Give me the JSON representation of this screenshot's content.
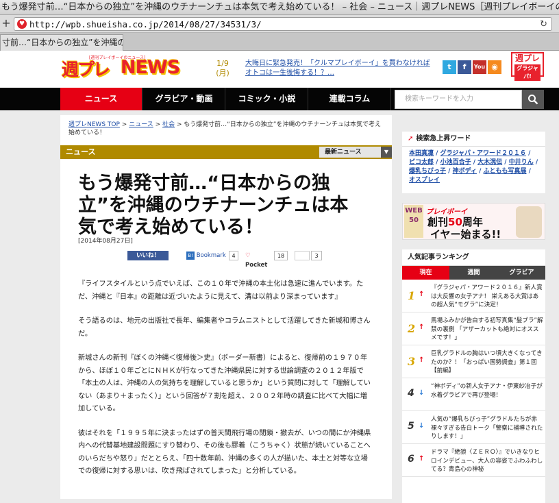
{
  "browser": {
    "window_title": "もう爆発寸前…“日本からの独立”を沖縄のウチナーンチュは本気で考え始めている！ – 社会 – ニュース｜週プレNEWS［週刊プレイボーイの",
    "url": "http://wpb.shueisha.co.jp/2014/08/27/34531/3/",
    "tab_title": "寸前…“日本からの独立”を沖縄のウチ…"
  },
  "header": {
    "logo_weekly": "週プレ",
    "logo_news": "NEWS",
    "logo_sub": "[週刊プレイボーイのニュース]",
    "date": "1/9",
    "weekday": "(月)",
    "headline_link": "大晦日に緊急発売！「クルマプレイボーイ」を買わなければオトコは一生後悔する！？…",
    "social": [
      "twitter-icon",
      "facebook-icon",
      "youtube-icon",
      "rss-icon"
    ],
    "badge_top": "週プレ",
    "badge_bottom": "グラジャパ!"
  },
  "nav": {
    "items": [
      "ニュース",
      "グラビア・動画",
      "コミック・小説",
      "連載コラム"
    ],
    "search_placeholder": "検索キーワードを入力"
  },
  "breadcrumb": {
    "home": "週プレNEWS TOP",
    "sep1": ">",
    "news": "ニュース",
    "sep2": ">",
    "category": "社会",
    "sep3": ">",
    "current": "もう爆発寸前…“日本からの独立”を沖縄のウチナーンチュは本気で考え始めている！"
  },
  "section": {
    "label": "ニュース",
    "latest": "最新ニュース"
  },
  "article": {
    "title": "もう爆発寸前…“日本からの独立”を沖縄のウチナーンチュは本気で考え始めている！",
    "date": "[2014年08月27日]",
    "share": {
      "like": "いいね！",
      "bookmark": "Bookmark",
      "bookmark_count": "4",
      "pocket": "Pocket",
      "pocket_count": "18",
      "other_count": "3"
    },
    "paragraphs": [
      "『ライフスタイルという点でいえば、この１０年で沖縄の本土化は急速に進んでいます。ただ、沖縄と『日本』の距離は近づいたように見えて、溝は以前より深まっています』",
      "そう語るのは、地元の出版社で長年、編集者やコラムニストとして活躍してきた新城和博さんだ。",
      "新城さんの新刊『ぼくの沖縄＜復帰後＞史』（ボーダー新書）によると、復帰前の１９７０年から、ほぼ１０年ごとにＮＨＫが行なってきた沖縄県民に対する世論調査の２０１２年版で「本土の人は、沖縄の人の気持ちを理解していると思うか」という質問に対して「理解していない（あまり＋まったく）」という回答が７割を超え、２００２年時の調査に比べて大幅に増加している。",
      "彼はそれを「１９９５年に決まったはずの普天間飛行場の閉鎖・撤去が、いつの間にか沖縄県内への代替基地建設問題にすり替わり、その後も膠着（こうちゃく）状態が続いていることへのいらだちや怒り」だととらえ、「四十数年前、沖縄の多くの人が描いた、本土と対等な立場での復帰に対する思いは、吹き飛ばされてしまった」と分析している。"
    ]
  },
  "sidebar": {
    "trend_title": "検索急上昇ワード",
    "trend_words": [
      "本田真凜",
      "グラジャパ・アワード２０１６",
      "ピコ太郎",
      "小池百合子",
      "大木滉伝",
      "中井りん",
      "爆乳ちびっ子",
      "神ボディ",
      "ふともも写真展",
      "オスプレイ"
    ],
    "banner_tag": "プレイボーイ",
    "banner_left": "WEB 50",
    "banner_line1_pre": "創刊",
    "banner_line1_num": "50",
    "banner_line1_post": "周年",
    "banner_line2": "イヤー始まる!!",
    "ranking_title": "人気記事ランキング",
    "ranking_tabs": [
      "現在",
      "週間",
      "グラビア"
    ],
    "ranking": [
      {
        "rank": "1",
        "trend": "up",
        "text": "『グラジャパ・アワード２０１６』新人賞は大反響の女子アナ！ 栄えある大賞はあの超人気“モグラ”に決定！"
      },
      {
        "rank": "2",
        "trend": "up",
        "text": "馬場ふみかが告白する初写真集“髪ブラ”解禁の裏側 「アザーカットも絶対にオススメです！」"
      },
      {
        "rank": "3",
        "trend": "up",
        "text": "巨乳グラドルの胸はいつ頃大きくなってきたのか？！「おっぱい国勢調査」第１回【前編】"
      },
      {
        "rank": "4",
        "trend": "down",
        "text": "“神ボディ”の新人女子アナ・伊東紗冶子が水着グラビアで再び登場！"
      },
      {
        "rank": "5",
        "trend": "down",
        "text": "人気の“爆乳ちびっ子”グラドルたちが赤裸々すぎる告白トーク「警察に補導されたりします！」"
      },
      {
        "rank": "6",
        "trend": "up",
        "text": "ドラマ『絶狼〈ＺＥＲＯ〉』でいきなりヒロインデビュー、大人の容姿でふわふわしてる？青島心の神秘"
      }
    ]
  },
  "colors": {
    "accent_red": "#e60014",
    "section_gold": "#b08a00",
    "link_blue": "#1f4ea6",
    "nav_black": "#050505"
  }
}
